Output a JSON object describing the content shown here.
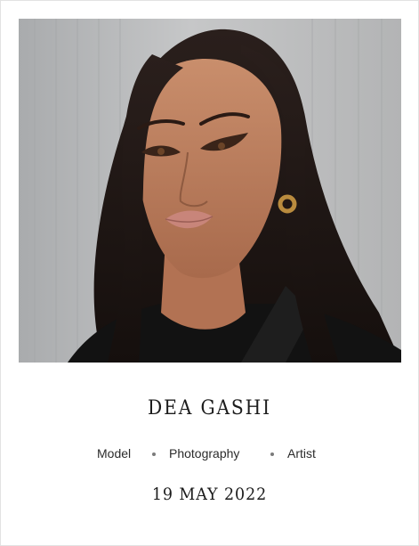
{
  "profile": {
    "name": "DEA GASHI",
    "date": "19 MAY 2022",
    "tags": [
      "Model",
      "Photography",
      "Artist"
    ]
  },
  "photo": {
    "subject": "portrait-photo"
  },
  "colors": {
    "background": "#ffffff",
    "text": "#1c1c1c",
    "separator_dot": "#7a7a7a"
  }
}
